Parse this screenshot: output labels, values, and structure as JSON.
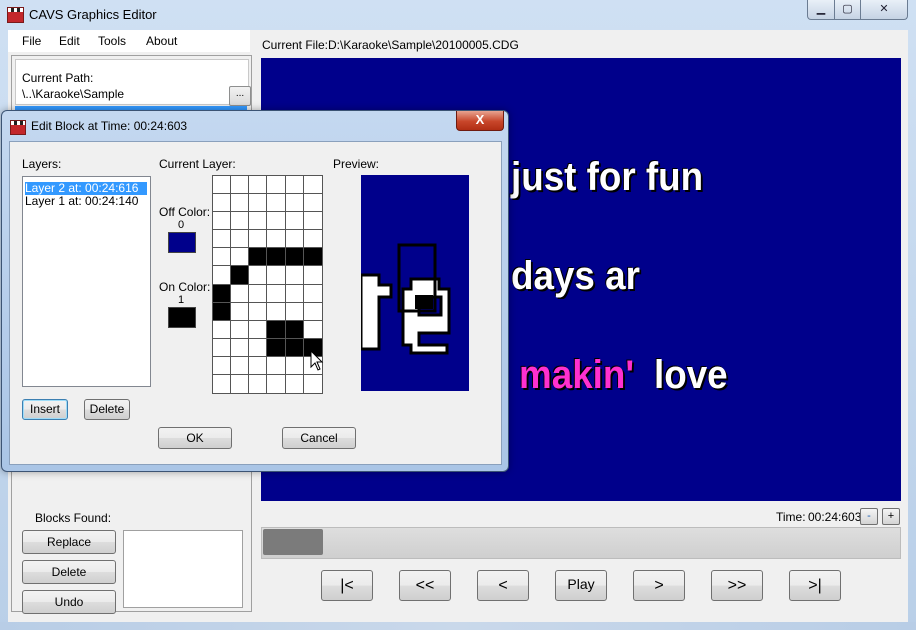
{
  "app": {
    "title": "CAVS Graphics Editor",
    "min_label": "▭",
    "max_label": "▢",
    "close_label": "✕"
  },
  "menu": {
    "file": "File",
    "edit": "Edit",
    "tools": "Tools",
    "about": "About"
  },
  "path": {
    "label": "Current Path:",
    "value": "\\..\\Karaoke\\Sample",
    "browse_label": "..."
  },
  "current_file": {
    "label": "Current File:",
    "value": "D:\\Karaoke\\Sample\\20100005.CDG"
  },
  "lyrics": {
    "line1": "just for fun",
    "line2": "days ar",
    "line3_highlight": "makin'",
    "line3_rest": "love"
  },
  "time": {
    "label": "Time:",
    "value": "00:24:603",
    "minus": "-",
    "plus": "+"
  },
  "progress": {
    "fraction": 0.095
  },
  "transport": {
    "first": "|<",
    "rewind": "<<",
    "prev": "<",
    "play": "Play",
    "next": ">",
    "forward": ">>",
    "last": ">|"
  },
  "blocks": {
    "label": "Blocks Found:",
    "replace": "Replace",
    "delete": "Delete",
    "undo": "Undo"
  },
  "dialog": {
    "title": "Edit Block at Time: 00:24:603",
    "close_label": "X",
    "layers_label": "Layers:",
    "layers": [
      "Layer 2 at: 00:24:616",
      "Layer 1 at: 00:24:140"
    ],
    "selected_layer": 0,
    "current_layer_label": "Current Layer:",
    "off_color_label": "Off Color:",
    "off_color_index": "0",
    "off_color": "#00008b",
    "on_color_label": "On Color:",
    "on_color_index": "1",
    "on_color": "#000000",
    "preview_label": "Preview:",
    "insert": "Insert",
    "delete": "Delete",
    "ok": "OK",
    "cancel": "Cancel",
    "pixels": [
      [
        0,
        0,
        0,
        0,
        0,
        0
      ],
      [
        0,
        0,
        0,
        0,
        0,
        0
      ],
      [
        0,
        0,
        0,
        0,
        0,
        0
      ],
      [
        0,
        0,
        0,
        0,
        0,
        0
      ],
      [
        0,
        0,
        1,
        1,
        1,
        1
      ],
      [
        0,
        1,
        0,
        0,
        0,
        0
      ],
      [
        1,
        0,
        0,
        0,
        0,
        0
      ],
      [
        1,
        0,
        0,
        0,
        0,
        0
      ],
      [
        0,
        0,
        0,
        1,
        1,
        0
      ],
      [
        0,
        0,
        0,
        1,
        1,
        1
      ],
      [
        0,
        0,
        0,
        0,
        0,
        0
      ],
      [
        0,
        0,
        0,
        0,
        0,
        0
      ]
    ]
  },
  "colors": {
    "canvas_bg": "#00008b",
    "highlight": "#ff30d0",
    "selection": "#3399ff"
  }
}
